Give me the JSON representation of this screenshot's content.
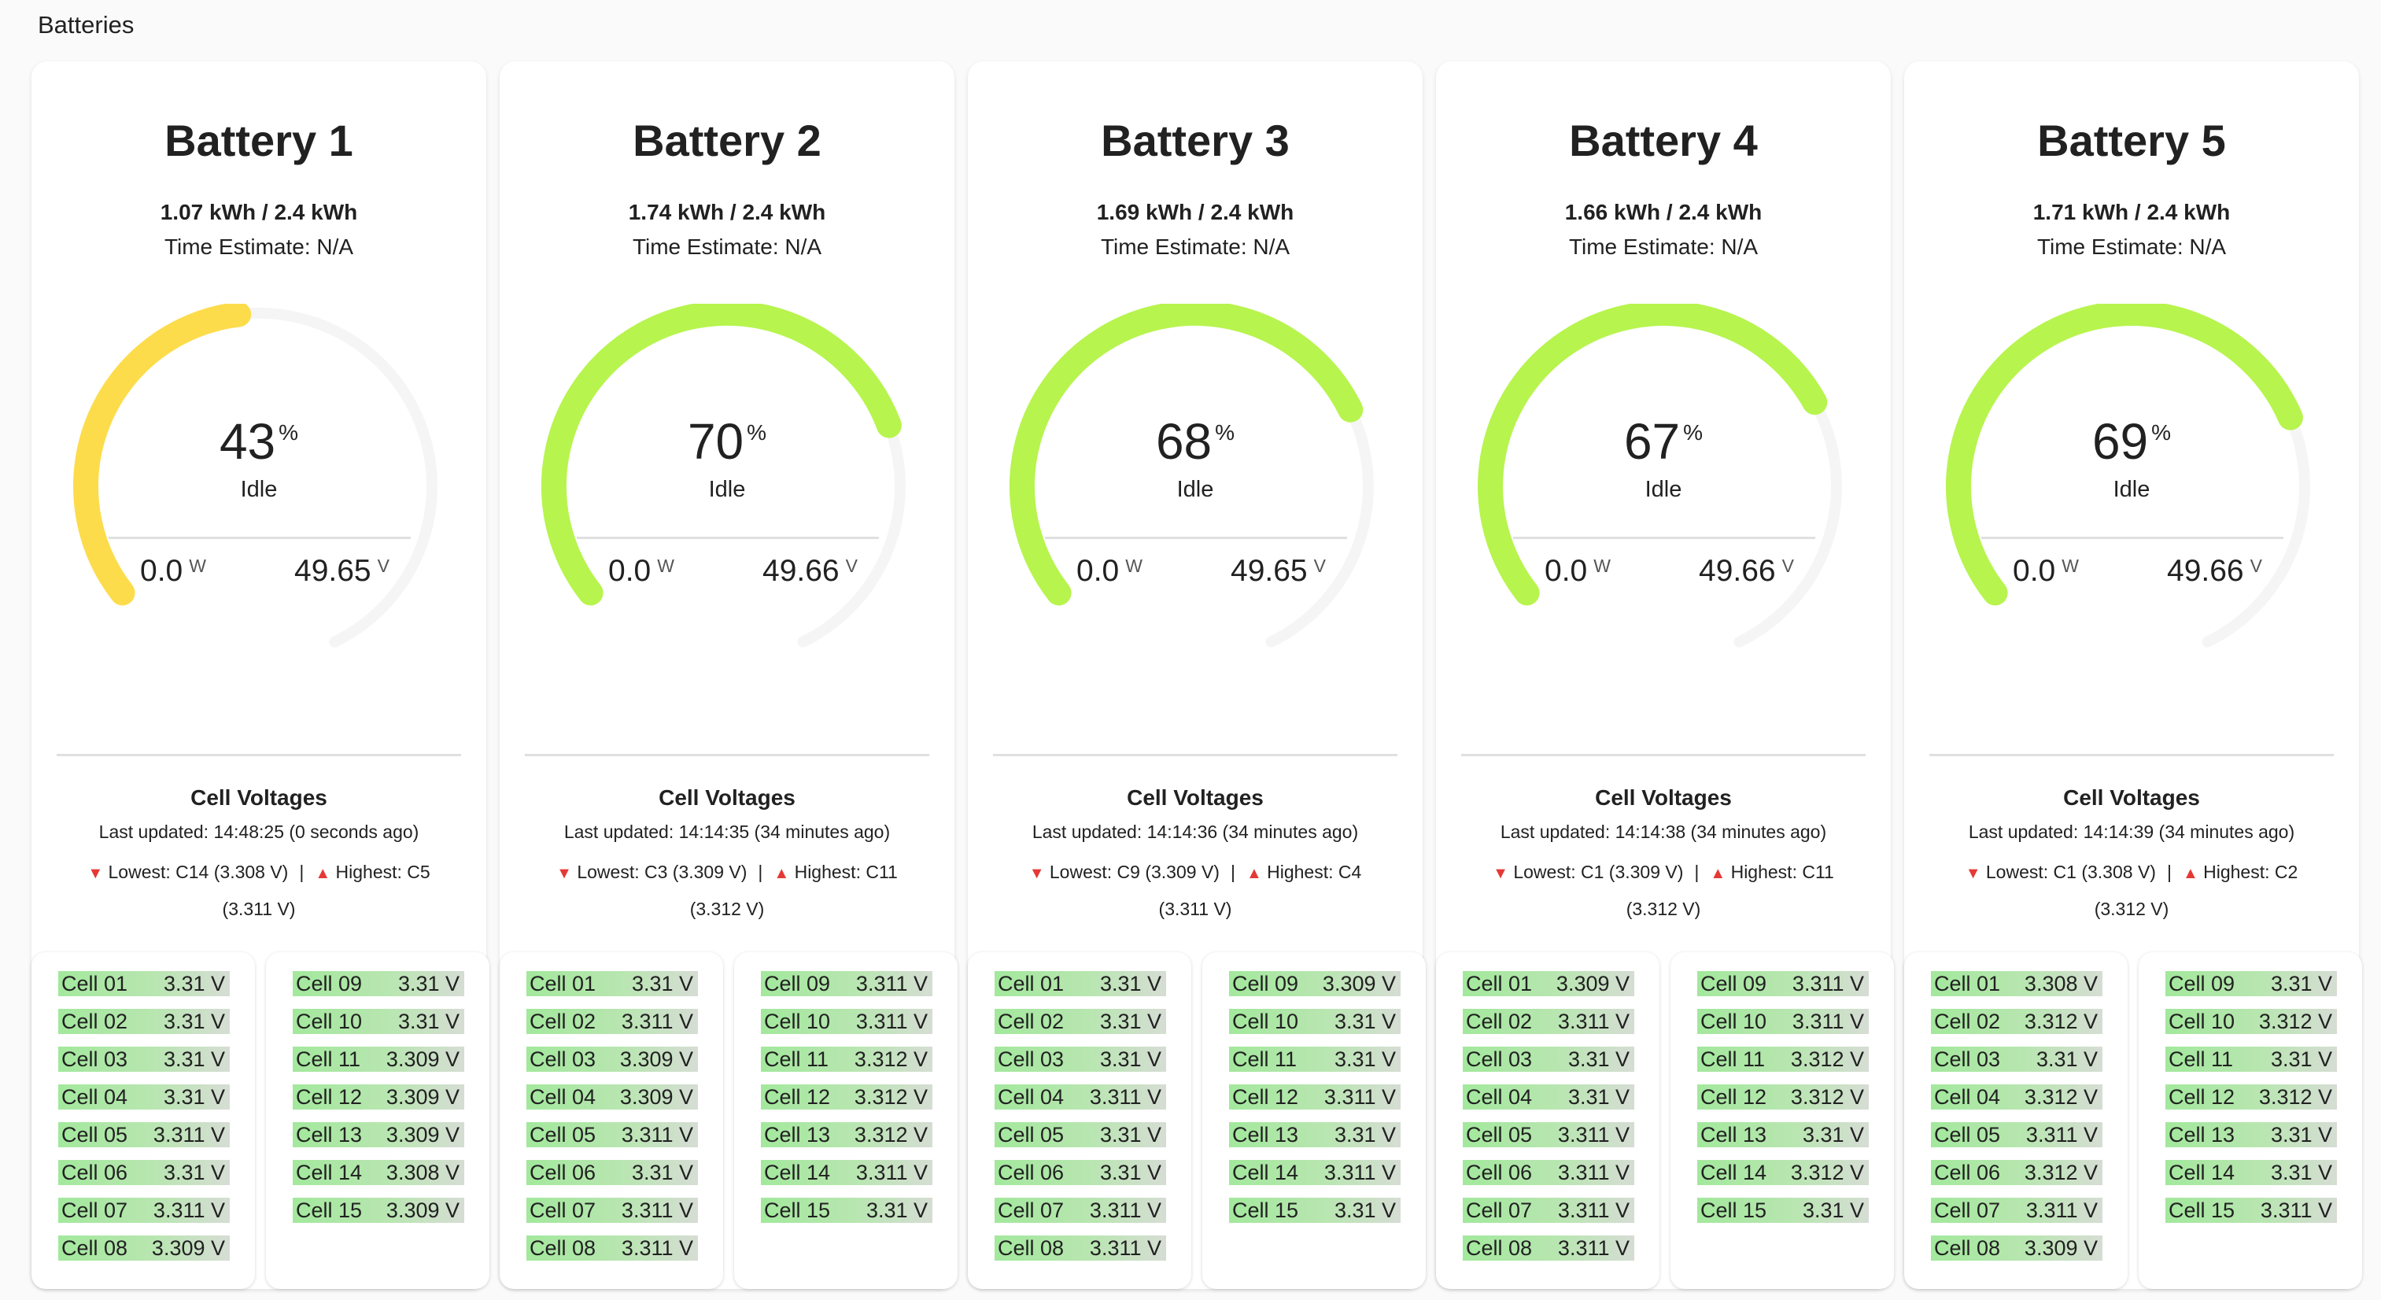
{
  "section_title": "Batteries",
  "labels": {
    "cell_voltages": "Cell Voltages",
    "power_unit": "W",
    "voltage_unit": "V",
    "pct_unit": "%"
  },
  "colors": {
    "gauge_low": "#fddc4c",
    "gauge_high": "#b7f44e",
    "gauge_track": "#f5f5f5"
  },
  "batteries": [
    {
      "title": "Battery 1",
      "energy": "1.07 kWh / 2.4 kWh",
      "estimate": "Time Estimate: N/A",
      "percent": "43",
      "state": "Idle",
      "power": "0.0",
      "voltage": "49.65",
      "updated": "Last updated: 14:48:25 (0 seconds ago)",
      "lowest": "Lowest: C14 (3.308 V)",
      "highest": "Highest: C5 (3.311 V)",
      "cells_left": [
        {
          "name": "Cell 01",
          "value": "3.31 V"
        },
        {
          "name": "Cell 02",
          "value": "3.31 V"
        },
        {
          "name": "Cell 03",
          "value": "3.31 V"
        },
        {
          "name": "Cell 04",
          "value": "3.31 V"
        },
        {
          "name": "Cell 05",
          "value": "3.311 V"
        },
        {
          "name": "Cell 06",
          "value": "3.31 V"
        },
        {
          "name": "Cell 07",
          "value": "3.311 V"
        },
        {
          "name": "Cell 08",
          "value": "3.309 V"
        }
      ],
      "cells_right": [
        {
          "name": "Cell 09",
          "value": "3.31 V"
        },
        {
          "name": "Cell 10",
          "value": "3.31 V"
        },
        {
          "name": "Cell 11",
          "value": "3.309 V"
        },
        {
          "name": "Cell 12",
          "value": "3.309 V"
        },
        {
          "name": "Cell 13",
          "value": "3.309 V"
        },
        {
          "name": "Cell 14",
          "value": "3.308 V"
        },
        {
          "name": "Cell 15",
          "value": "3.309 V"
        }
      ]
    },
    {
      "title": "Battery 2",
      "energy": "1.74 kWh / 2.4 kWh",
      "estimate": "Time Estimate: N/A",
      "percent": "70",
      "state": "Idle",
      "power": "0.0",
      "voltage": "49.66",
      "updated": "Last updated: 14:14:35 (34 minutes ago)",
      "lowest": "Lowest: C3 (3.309 V)",
      "highest": "Highest: C11 (3.312 V)",
      "cells_left": [
        {
          "name": "Cell 01",
          "value": "3.31 V"
        },
        {
          "name": "Cell 02",
          "value": "3.311 V"
        },
        {
          "name": "Cell 03",
          "value": "3.309 V"
        },
        {
          "name": "Cell 04",
          "value": "3.309 V"
        },
        {
          "name": "Cell 05",
          "value": "3.311 V"
        },
        {
          "name": "Cell 06",
          "value": "3.31 V"
        },
        {
          "name": "Cell 07",
          "value": "3.311 V"
        },
        {
          "name": "Cell 08",
          "value": "3.311 V"
        }
      ],
      "cells_right": [
        {
          "name": "Cell 09",
          "value": "3.311 V"
        },
        {
          "name": "Cell 10",
          "value": "3.311 V"
        },
        {
          "name": "Cell 11",
          "value": "3.312 V"
        },
        {
          "name": "Cell 12",
          "value": "3.312 V"
        },
        {
          "name": "Cell 13",
          "value": "3.312 V"
        },
        {
          "name": "Cell 14",
          "value": "3.311 V"
        },
        {
          "name": "Cell 15",
          "value": "3.31 V"
        }
      ]
    },
    {
      "title": "Battery 3",
      "energy": "1.69 kWh / 2.4 kWh",
      "estimate": "Time Estimate: N/A",
      "percent": "68",
      "state": "Idle",
      "power": "0.0",
      "voltage": "49.65",
      "updated": "Last updated: 14:14:36 (34 minutes ago)",
      "lowest": "Lowest: C9 (3.309 V)",
      "highest": "Highest: C4 (3.311 V)",
      "cells_left": [
        {
          "name": "Cell 01",
          "value": "3.31 V"
        },
        {
          "name": "Cell 02",
          "value": "3.31 V"
        },
        {
          "name": "Cell 03",
          "value": "3.31 V"
        },
        {
          "name": "Cell 04",
          "value": "3.311 V"
        },
        {
          "name": "Cell 05",
          "value": "3.31 V"
        },
        {
          "name": "Cell 06",
          "value": "3.31 V"
        },
        {
          "name": "Cell 07",
          "value": "3.311 V"
        },
        {
          "name": "Cell 08",
          "value": "3.311 V"
        }
      ],
      "cells_right": [
        {
          "name": "Cell 09",
          "value": "3.309 V"
        },
        {
          "name": "Cell 10",
          "value": "3.31 V"
        },
        {
          "name": "Cell 11",
          "value": "3.31 V"
        },
        {
          "name": "Cell 12",
          "value": "3.311 V"
        },
        {
          "name": "Cell 13",
          "value": "3.31 V"
        },
        {
          "name": "Cell 14",
          "value": "3.311 V"
        },
        {
          "name": "Cell 15",
          "value": "3.31 V"
        }
      ]
    },
    {
      "title": "Battery 4",
      "energy": "1.66 kWh / 2.4 kWh",
      "estimate": "Time Estimate: N/A",
      "percent": "67",
      "state": "Idle",
      "power": "0.0",
      "voltage": "49.66",
      "updated": "Last updated: 14:14:38 (34 minutes ago)",
      "lowest": "Lowest: C1 (3.309 V)",
      "highest": "Highest: C11 (3.312 V)",
      "cells_left": [
        {
          "name": "Cell 01",
          "value": "3.309 V"
        },
        {
          "name": "Cell 02",
          "value": "3.311 V"
        },
        {
          "name": "Cell 03",
          "value": "3.31 V"
        },
        {
          "name": "Cell 04",
          "value": "3.31 V"
        },
        {
          "name": "Cell 05",
          "value": "3.311 V"
        },
        {
          "name": "Cell 06",
          "value": "3.311 V"
        },
        {
          "name": "Cell 07",
          "value": "3.311 V"
        },
        {
          "name": "Cell 08",
          "value": "3.311 V"
        }
      ],
      "cells_right": [
        {
          "name": "Cell 09",
          "value": "3.311 V"
        },
        {
          "name": "Cell 10",
          "value": "3.311 V"
        },
        {
          "name": "Cell 11",
          "value": "3.312 V"
        },
        {
          "name": "Cell 12",
          "value": "3.312 V"
        },
        {
          "name": "Cell 13",
          "value": "3.31 V"
        },
        {
          "name": "Cell 14",
          "value": "3.312 V"
        },
        {
          "name": "Cell 15",
          "value": "3.31 V"
        }
      ]
    },
    {
      "title": "Battery 5",
      "energy": "1.71 kWh / 2.4 kWh",
      "estimate": "Time Estimate: N/A",
      "percent": "69",
      "state": "Idle",
      "power": "0.0",
      "voltage": "49.66",
      "updated": "Last updated: 14:14:39 (34 minutes ago)",
      "lowest": "Lowest: C1 (3.308 V)",
      "highest": "Highest: C2 (3.312 V)",
      "cells_left": [
        {
          "name": "Cell 01",
          "value": "3.308 V"
        },
        {
          "name": "Cell 02",
          "value": "3.312 V"
        },
        {
          "name": "Cell 03",
          "value": "3.31 V"
        },
        {
          "name": "Cell 04",
          "value": "3.312 V"
        },
        {
          "name": "Cell 05",
          "value": "3.311 V"
        },
        {
          "name": "Cell 06",
          "value": "3.312 V"
        },
        {
          "name": "Cell 07",
          "value": "3.311 V"
        },
        {
          "name": "Cell 08",
          "value": "3.309 V"
        }
      ],
      "cells_right": [
        {
          "name": "Cell 09",
          "value": "3.31 V"
        },
        {
          "name": "Cell 10",
          "value": "3.312 V"
        },
        {
          "name": "Cell 11",
          "value": "3.31 V"
        },
        {
          "name": "Cell 12",
          "value": "3.312 V"
        },
        {
          "name": "Cell 13",
          "value": "3.31 V"
        },
        {
          "name": "Cell 14",
          "value": "3.31 V"
        },
        {
          "name": "Cell 15",
          "value": "3.311 V"
        }
      ]
    }
  ]
}
